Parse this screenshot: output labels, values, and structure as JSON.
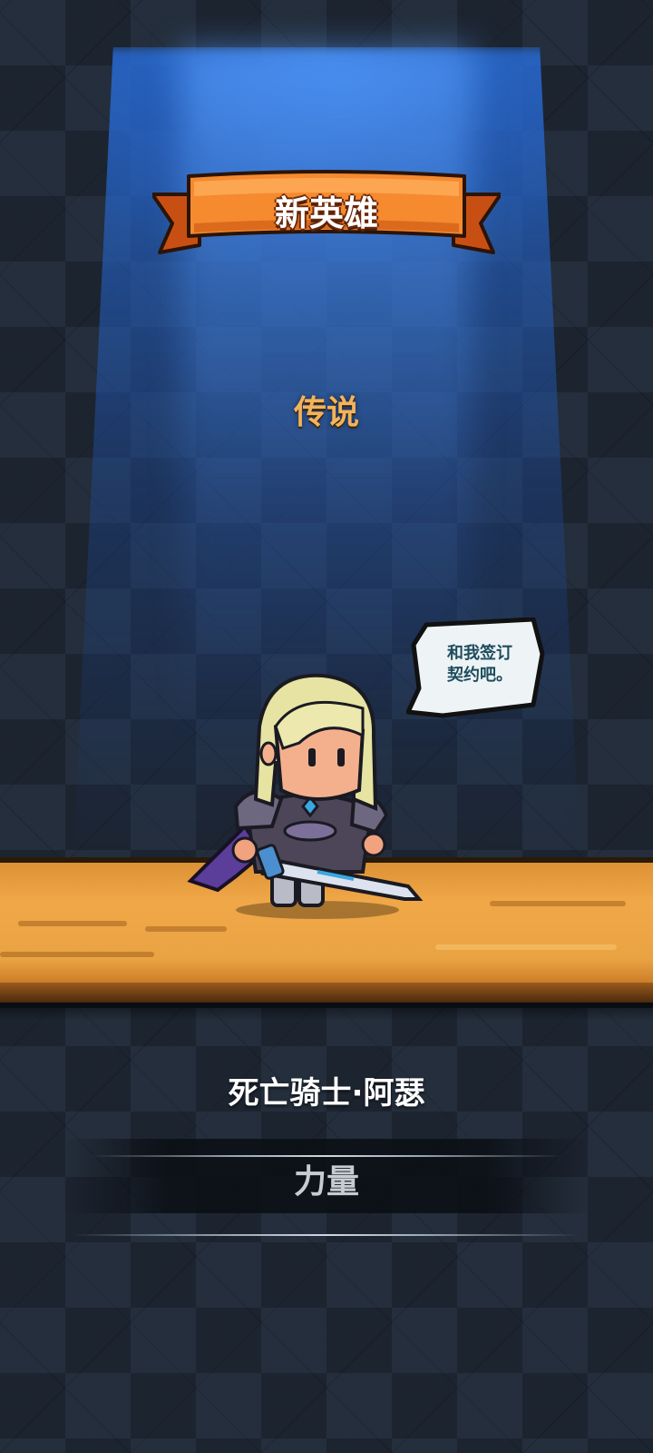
{
  "title": "新英雄",
  "rarity": "传说",
  "speech": {
    "line1": "和我签订",
    "line2": "契约吧。"
  },
  "hero": {
    "name": "死亡骑士·阿瑟",
    "attribute": "力量"
  },
  "colors": {
    "ribbon": "#f07a2a",
    "rarity": "#f2b35c",
    "floor": "#eaa343",
    "spotlight": "#2f78d8"
  }
}
